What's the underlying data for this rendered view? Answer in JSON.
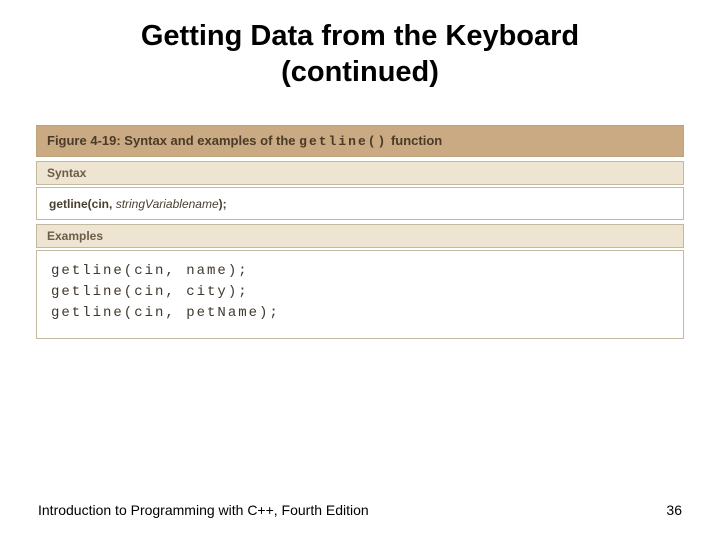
{
  "title_line1": "Getting Data from the Keyboard",
  "title_line2": "(continued)",
  "figure": {
    "caption_prefix": "Figure 4-19: Syntax and examples of the ",
    "caption_code": "getline()",
    "caption_suffix": " function",
    "syntax_label": "Syntax",
    "syntax_text_a": "getline(cin, ",
    "syntax_text_ital": "stringVariablename",
    "syntax_text_b": ");",
    "examples_label": "Examples",
    "examples": [
      "getline(cin, name);",
      "getline(cin, city);",
      "getline(cin, petName);"
    ]
  },
  "footer": {
    "left": "Introduction to Programming with C++, Fourth Edition",
    "page": "36"
  }
}
